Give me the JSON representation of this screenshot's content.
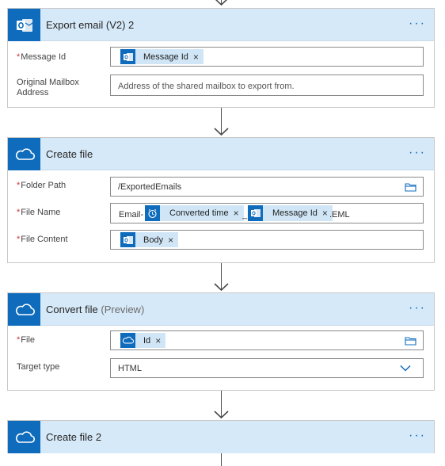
{
  "cards": {
    "export": {
      "title": "Export email (V2) 2",
      "more": "···",
      "message_id_label": "Message Id",
      "message_id_token": "Message Id",
      "mailbox_label_line1": "Original Mailbox",
      "mailbox_label_line2": "Address",
      "mailbox_placeholder": "Address of the shared mailbox to export from."
    },
    "create_file": {
      "title": "Create file",
      "more": "···",
      "folder_label": "Folder Path",
      "folder_value": "/ExportedEmails",
      "file_name_label": "File Name",
      "file_name_prefix": "Email-",
      "file_name_token1": "Converted time",
      "file_name_sep": "_",
      "file_name_token2": "Message Id",
      "file_name_suffix": ".EML",
      "content_label": "File Content",
      "content_token": "Body"
    },
    "convert_file": {
      "title": "Convert file",
      "title_suffix": "(Preview)",
      "more": "···",
      "file_label": "File",
      "file_token": "Id",
      "target_label": "Target type",
      "target_value": "HTML"
    },
    "create_file_2": {
      "title": "Create file 2",
      "more": "···"
    }
  },
  "required_mark": "*",
  "token_remove": "×",
  "colors": {
    "accent": "#0f6cbd",
    "header_bg": "#d6e9f8",
    "token_bg": "#d0e6f7",
    "required": "#d13438"
  },
  "icons": {
    "outlook": "outlook-icon",
    "onedrive": "onedrive-icon",
    "clock": "clock-icon",
    "folder": "folder-icon",
    "chevron": "chevron-down-icon",
    "arrow": "arrow-down-icon"
  }
}
